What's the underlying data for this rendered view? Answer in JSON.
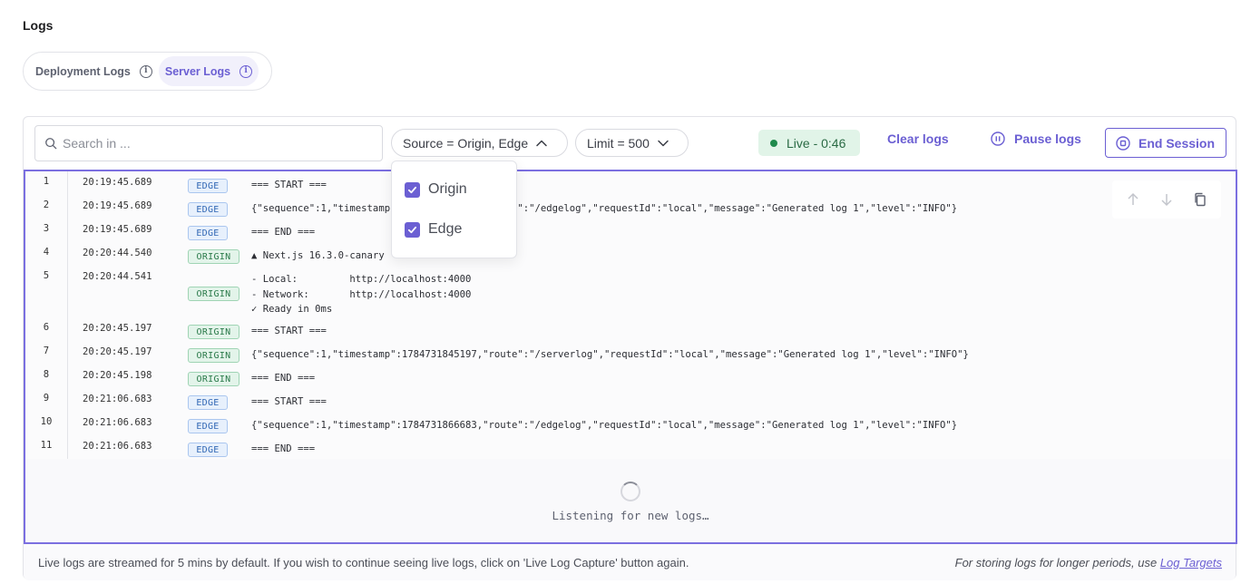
{
  "page_title": "Logs",
  "tabs": [
    {
      "label": "Deployment Logs"
    },
    {
      "label": "Server Logs"
    }
  ],
  "toolbar": {
    "search_placeholder": "Search in ...",
    "source_filter": "Source = Origin, Edge",
    "limit_filter": "Limit = 500",
    "live_status": "Live - 0:46",
    "clear_label": "Clear logs",
    "pause_label": "Pause logs",
    "end_label": "End Session"
  },
  "source_options": [
    {
      "label": "Origin",
      "checked": true
    },
    {
      "label": "Edge",
      "checked": true
    }
  ],
  "logs": [
    {
      "n": "1",
      "ts": "20:19:45.689",
      "source": "EDGE",
      "msg": "=== START ==="
    },
    {
      "n": "2",
      "ts": "20:19:45.689",
      "source": "EDGE",
      "msg": "{\"sequence\":1,\"timestamp\":1784731785689,\"route\":\"/edgelog\",\"requestId\":\"local\",\"message\":\"Generated log 1\",\"level\":\"INFO\"}"
    },
    {
      "n": "3",
      "ts": "20:19:45.689",
      "source": "EDGE",
      "msg": "=== END ==="
    },
    {
      "n": "4",
      "ts": "20:20:44.540",
      "source": "ORIGIN",
      "msg": "▲ Next.js 16.3.0-canary"
    },
    {
      "n": "5",
      "ts": "20:20:44.541",
      "source": "ORIGIN",
      "msg": "- Local:         http://localhost:4000\n- Network:       http://localhost:4000\n✓ Ready in 0ms"
    },
    {
      "n": "6",
      "ts": "20:20:45.197",
      "source": "ORIGIN",
      "msg": "=== START ==="
    },
    {
      "n": "7",
      "ts": "20:20:45.197",
      "source": "ORIGIN",
      "msg": "{\"sequence\":1,\"timestamp\":1784731845197,\"route\":\"/serverlog\",\"requestId\":\"local\",\"message\":\"Generated log 1\",\"level\":\"INFO\"}"
    },
    {
      "n": "8",
      "ts": "20:20:45.198",
      "source": "ORIGIN",
      "msg": "=== END ==="
    },
    {
      "n": "9",
      "ts": "20:21:06.683",
      "source": "EDGE",
      "msg": "=== START ==="
    },
    {
      "n": "10",
      "ts": "20:21:06.683",
      "source": "EDGE",
      "msg": "{\"sequence\":1,\"timestamp\":1784731866683,\"route\":\"/edgelog\",\"requestId\":\"local\",\"message\":\"Generated log 1\",\"level\":\"INFO\"}"
    },
    {
      "n": "11",
      "ts": "20:21:06.683",
      "source": "EDGE",
      "msg": "=== END ==="
    }
  ],
  "listening_text": "Listening for new logs…",
  "footer": {
    "info": "Live logs are streamed for 5 mins by default. If you wish to continue seeing live logs, click on 'Live Log Capture' button again.",
    "storage_text": "For storing logs for longer periods, use ",
    "storage_link": "Log Targets"
  },
  "colors": {
    "accent": "#6b5fd3",
    "live_bg": "#e1f4e8",
    "edge_tag": "#3167b4",
    "origin_tag": "#2a7a4a"
  }
}
